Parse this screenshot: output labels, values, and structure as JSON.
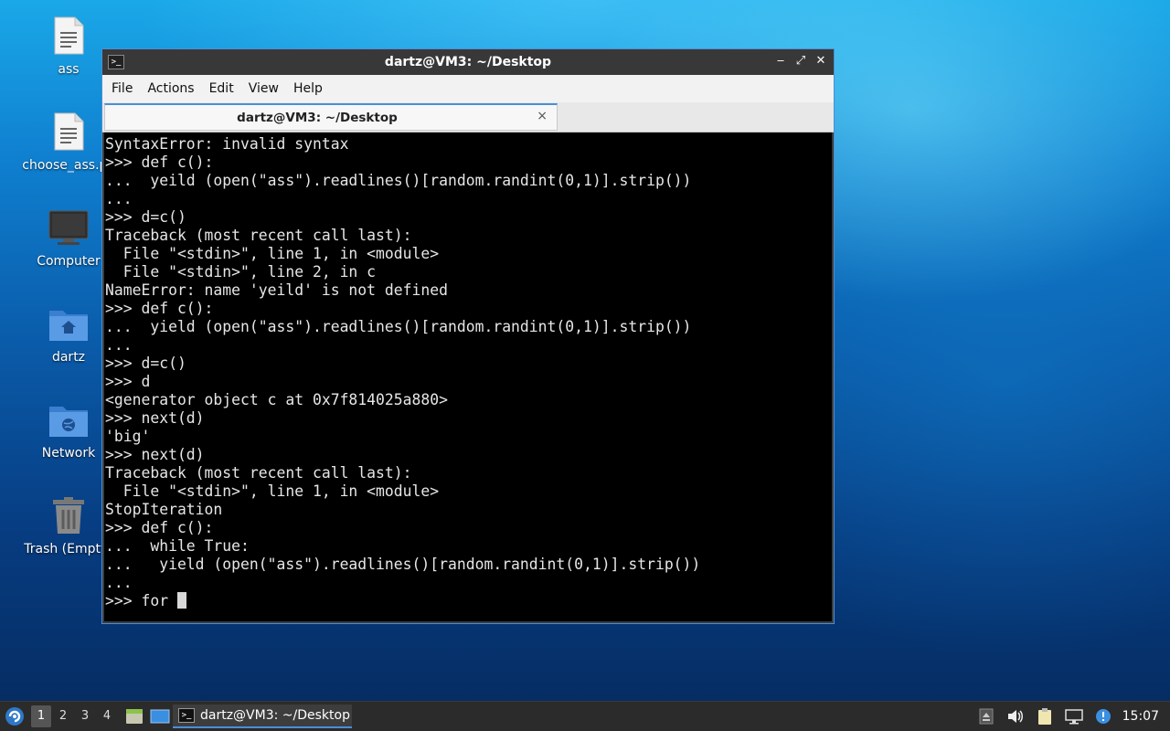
{
  "desktop": {
    "icons": [
      {
        "label": "ass",
        "icon": "text-file-icon"
      },
      {
        "label": "choose_ass.py",
        "icon": "text-file-icon"
      },
      {
        "label": "Computer",
        "icon": "computer-icon"
      },
      {
        "label": "dartz",
        "icon": "home-folder-icon"
      },
      {
        "label": "Network",
        "icon": "network-folder-icon"
      },
      {
        "label": "Trash (Empty)",
        "icon": "trash-icon"
      }
    ]
  },
  "window": {
    "title": "dartz@VM3: ~/Desktop",
    "controls": {
      "minimize": "‒",
      "maximize": "⤢",
      "close": "✕"
    },
    "menu": [
      "File",
      "Actions",
      "Edit",
      "View",
      "Help"
    ],
    "tab": {
      "title": "dartz@VM3: ~/Desktop",
      "close": "×"
    },
    "terminal_lines": [
      "SyntaxError: invalid syntax",
      ">>> def c():",
      "...  yeild (open(\"ass\").readlines()[random.randint(0,1)].strip())",
      "...",
      ">>> d=c()",
      "Traceback (most recent call last):",
      "  File \"<stdin>\", line 1, in <module>",
      "  File \"<stdin>\", line 2, in c",
      "NameError: name 'yeild' is not defined",
      ">>> def c():",
      "...  yield (open(\"ass\").readlines()[random.randint(0,1)].strip())",
      "...",
      ">>> d=c()",
      ">>> d",
      "<generator object c at 0x7f814025a880>",
      ">>> next(d)",
      "'big'",
      ">>> next(d)",
      "Traceback (most recent call last):",
      "  File \"<stdin>\", line 1, in <module>",
      "StopIteration",
      ">>> def c():",
      "...  while True:",
      "...   yield (open(\"ass\").readlines()[random.randint(0,1)].strip())",
      "..."
    ],
    "prompt_line": ">>> for "
  },
  "taskbar": {
    "workspaces": [
      "1",
      "2",
      "3",
      "4"
    ],
    "active_workspace": "1",
    "task_label": "dartz@VM3: ~/Desktop",
    "clock": "15:07",
    "accent": "#4a8fd6"
  }
}
